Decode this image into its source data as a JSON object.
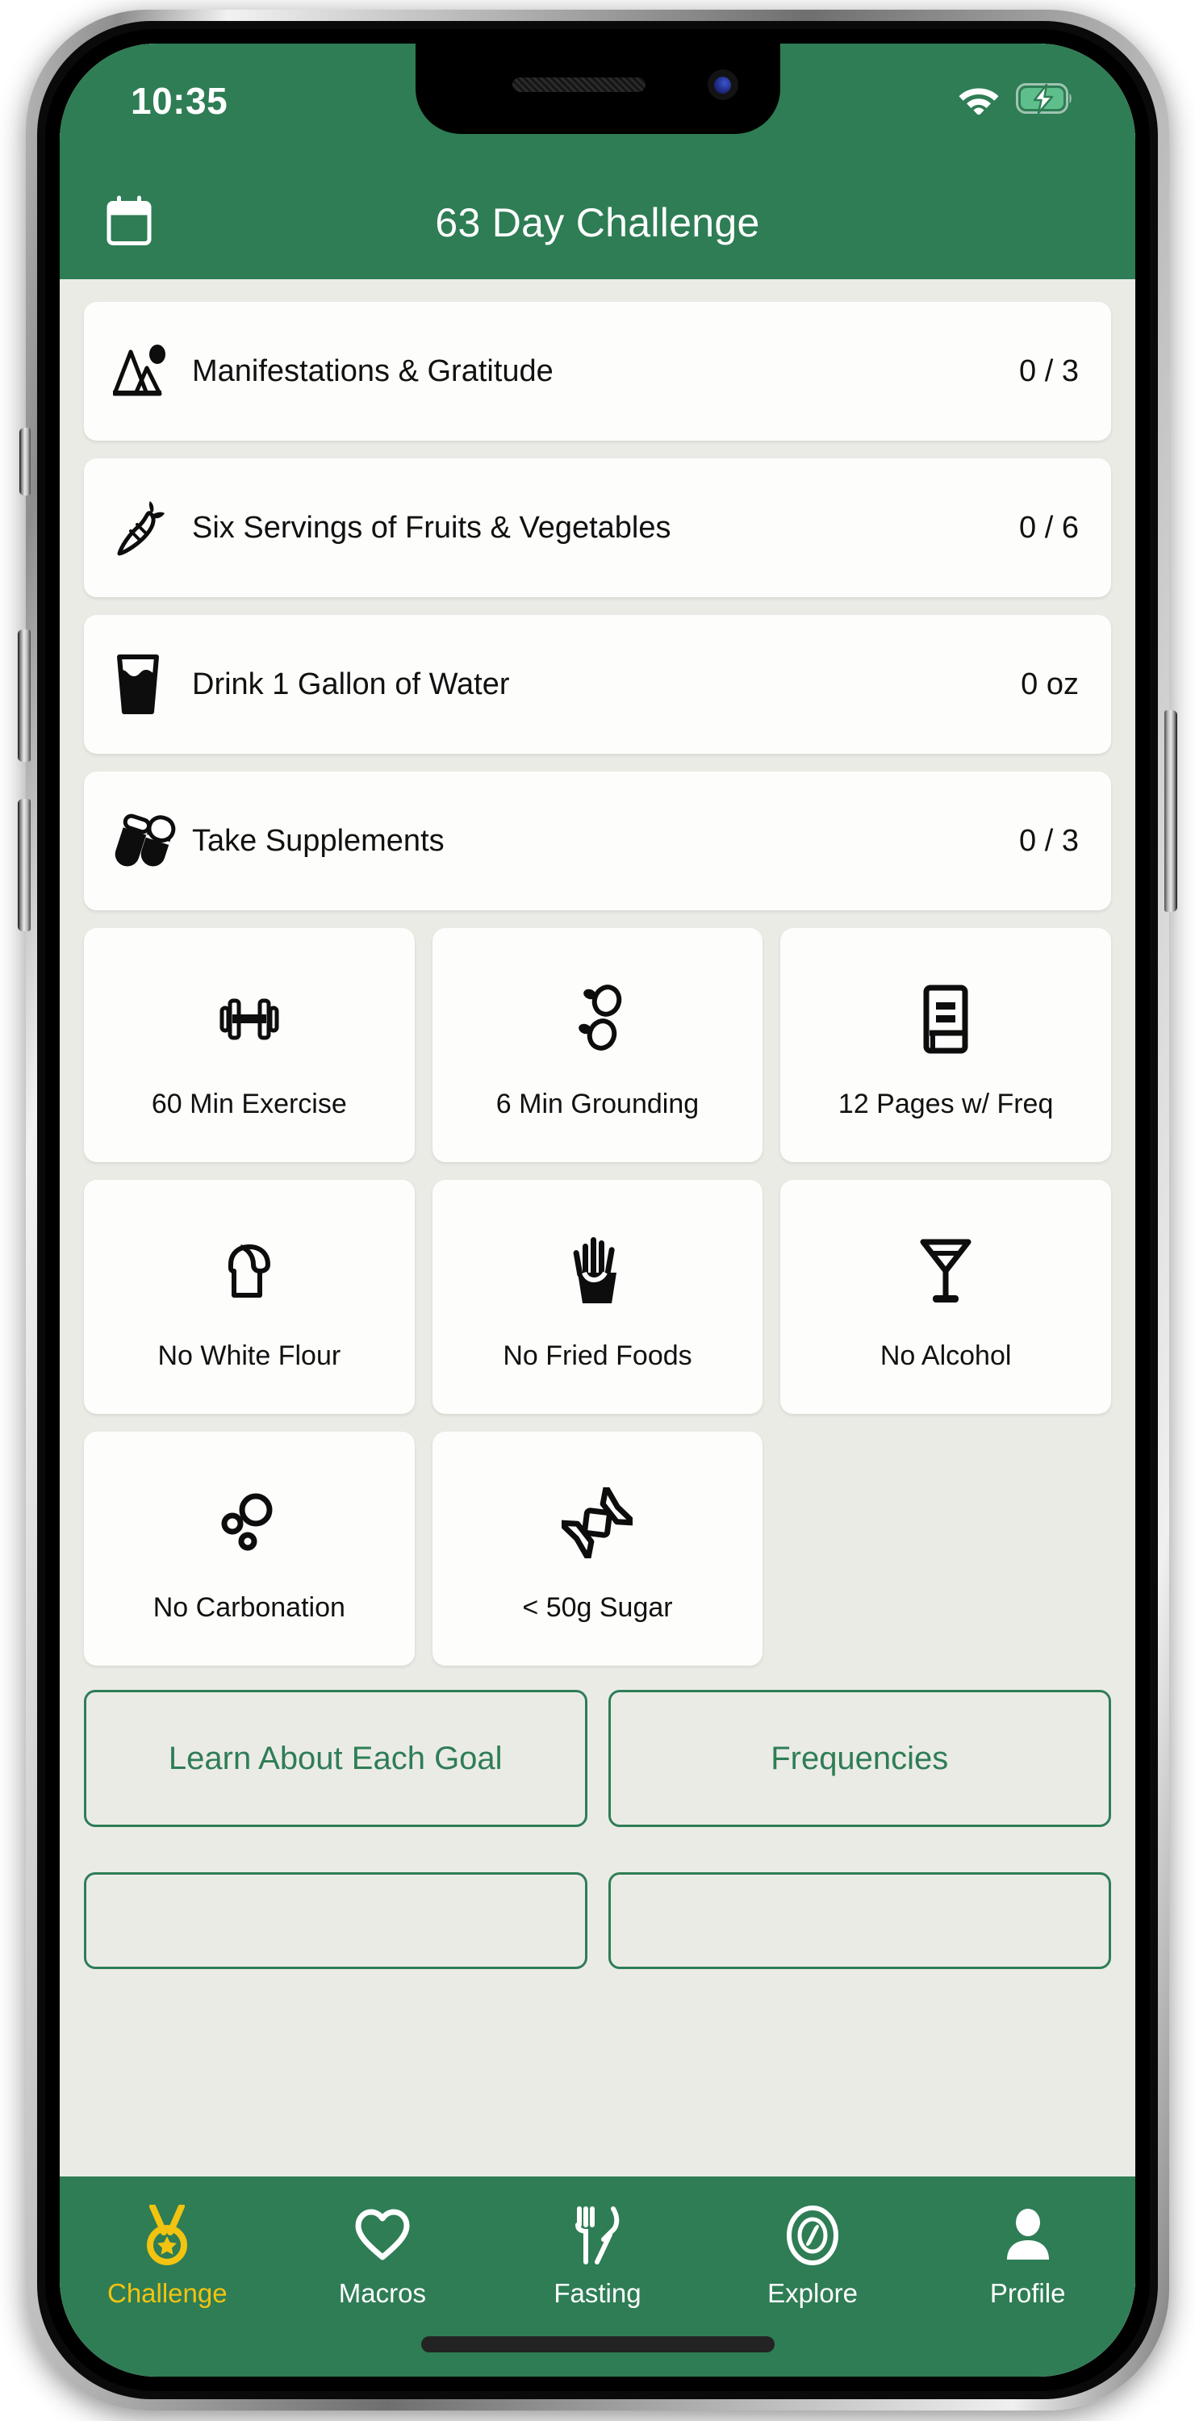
{
  "theme": {
    "brand_green": "#2E7D55",
    "accent_yellow": "#F2C310",
    "page_bg": "#EBEBE6",
    "card_bg": "#FDFDFB"
  },
  "status_bar": {
    "time": "10:35",
    "wifi_icon": "wifi-icon",
    "battery_icon": "battery-charging-icon"
  },
  "nav": {
    "calendar_icon": "calendar-icon",
    "title": "63 Day Challenge"
  },
  "goal_rows": [
    {
      "icon": "mountain-sun-icon",
      "label": "Manifestations & Gratitude",
      "count": "0 / 3"
    },
    {
      "icon": "carrot-icon",
      "label": "Six Servings of Fruits & Vegetables",
      "count": "0 / 6"
    },
    {
      "icon": "water-glass-icon",
      "label": "Drink 1 Gallon of Water",
      "count": "0 oz"
    },
    {
      "icon": "pills-icon",
      "label": "Take Supplements",
      "count": "0 / 3"
    }
  ],
  "goal_tiles": [
    {
      "icon": "dumbbell-icon",
      "label": "60 Min Exercise"
    },
    {
      "icon": "footprints-icon",
      "label": "6 Min Grounding"
    },
    {
      "icon": "book-icon",
      "label": "12 Pages w/ Freq"
    },
    {
      "icon": "bread-icon",
      "label": "No White Flour"
    },
    {
      "icon": "fries-icon",
      "label": "No Fried Foods"
    },
    {
      "icon": "cocktail-icon",
      "label": "No Alcohol"
    },
    {
      "icon": "bubbles-icon",
      "label": "No Carbonation"
    },
    {
      "icon": "candy-icon",
      "label": "< 50g Sugar"
    }
  ],
  "actions": {
    "learn_label": "Learn About Each Goal",
    "frequencies_label": "Frequencies"
  },
  "tabs": [
    {
      "icon": "medal-icon",
      "label": "Challenge",
      "active": true
    },
    {
      "icon": "heart-icon",
      "label": "Macros",
      "active": false
    },
    {
      "icon": "utensils-crossed-icon",
      "label": "Fasting",
      "active": false
    },
    {
      "icon": "compass-icon",
      "label": "Explore",
      "active": false
    },
    {
      "icon": "person-icon",
      "label": "Profile",
      "active": false
    }
  ]
}
